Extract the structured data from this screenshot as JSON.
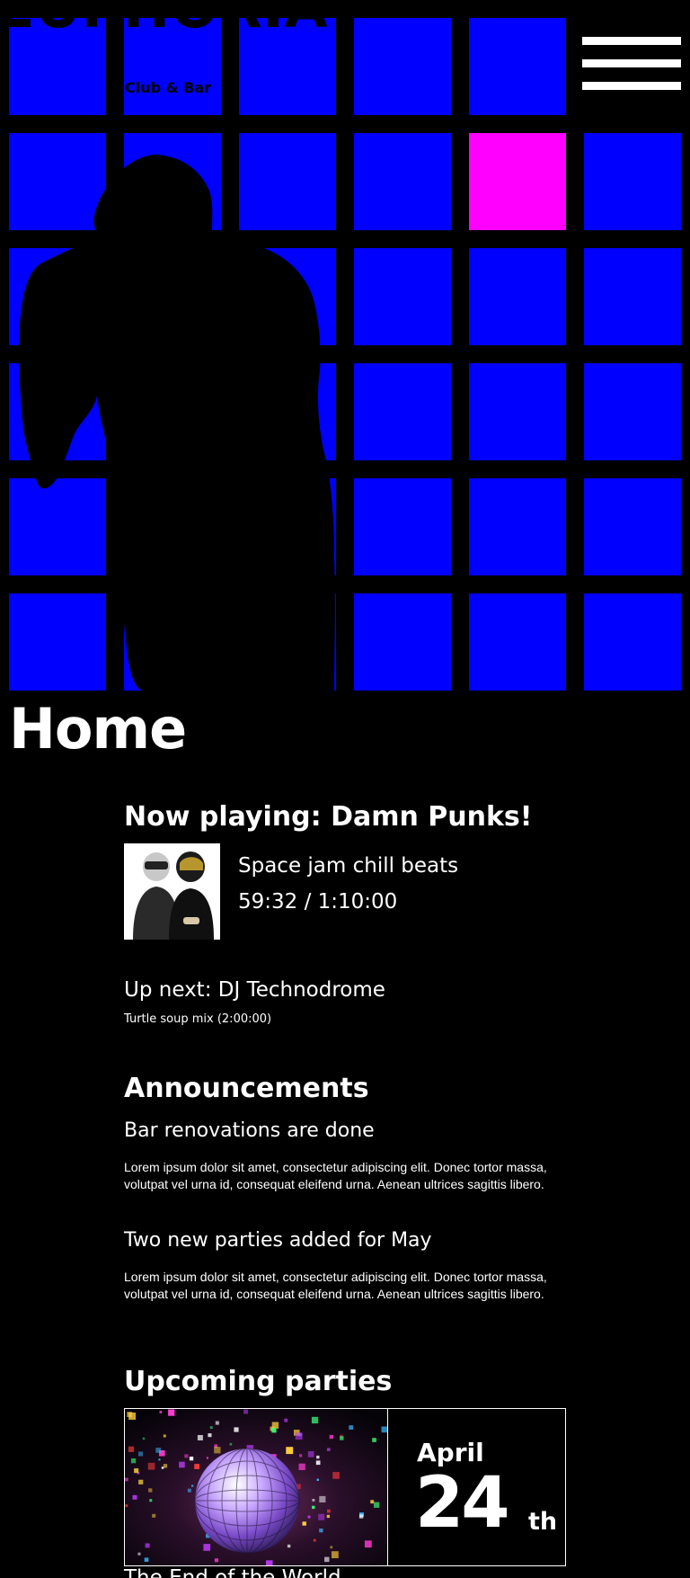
{
  "brand": {
    "name": "EUPHORIA",
    "tagline": "Club & Bar"
  },
  "colors": {
    "background": "#000000",
    "tile": "#0000ff",
    "tile_accent": "#ff00ff",
    "text": "#ffffff"
  },
  "icons": {
    "menu": "hamburger-icon"
  },
  "page": {
    "title": "Home"
  },
  "now_playing": {
    "heading": "Now playing: Damn Punks!",
    "track": "Space jam chill beats",
    "progress": "59:32 / 1:10:00"
  },
  "up_next": {
    "title": "Up next: DJ Technodrome",
    "subtitle": "Turtle soup mix (2:00:00)"
  },
  "announcements": {
    "heading": "Announcements",
    "items": [
      {
        "title": "Bar renovations are done",
        "body": "Lorem ipsum dolor sit amet, consectetur adipiscing elit. Donec tortor massa, volutpat vel urna id, consequat eleifend urna. Aenean ultrices sagittis libero."
      },
      {
        "title": "Two new parties added for May",
        "body": "Lorem ipsum dolor sit amet, consectetur adipiscing elit. Donec tortor massa, volutpat vel urna id, consequat eleifend urna. Aenean ultrices sagittis libero."
      }
    ]
  },
  "upcoming": {
    "heading": "Upcoming parties",
    "parties": [
      {
        "month": "April",
        "day": "24",
        "suffix": "th",
        "name": "The End of the World"
      }
    ]
  }
}
